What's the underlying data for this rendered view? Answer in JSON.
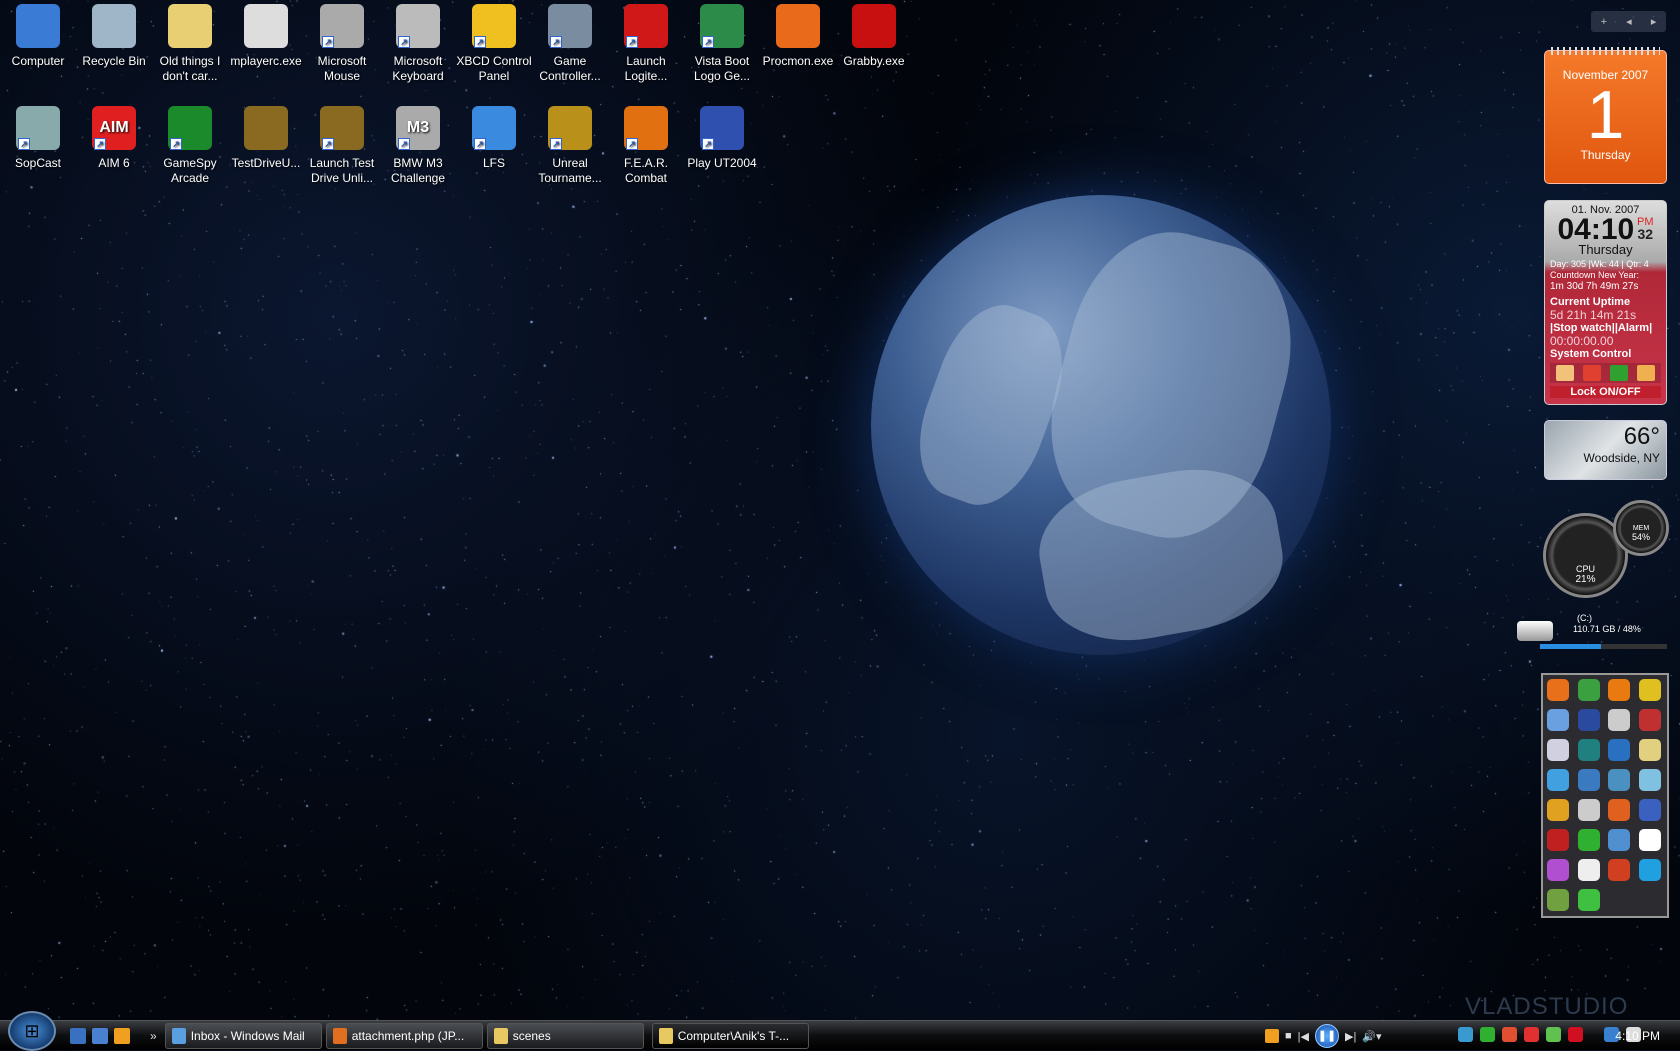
{
  "desktop": {
    "icons": [
      {
        "label": "Computer",
        "color": "#3a7bd5",
        "shortcut": false
      },
      {
        "label": "Recycle Bin",
        "color": "#9fb5c8",
        "shortcut": false
      },
      {
        "label": "Old things I don't car...",
        "color": "#e8cf74",
        "shortcut": false
      },
      {
        "label": "mplayerc.exe",
        "color": "#ddd",
        "shortcut": false
      },
      {
        "label": "Microsoft Mouse",
        "color": "#aaa",
        "shortcut": true
      },
      {
        "label": "Microsoft Keyboard",
        "color": "#bbb",
        "shortcut": true
      },
      {
        "label": "XBCD Control Panel",
        "color": "#f0c020",
        "shortcut": true
      },
      {
        "label": "Game Controller...",
        "color": "#7a8ca0",
        "shortcut": true
      },
      {
        "label": "Launch Logite...",
        "color": "#d01818",
        "shortcut": true
      },
      {
        "label": "Vista Boot Logo Ge...",
        "color": "#2d8b4a",
        "shortcut": true
      },
      {
        "label": "Procmon.exe",
        "color": "#e86a1a",
        "shortcut": false
      },
      {
        "label": "Grabby.exe",
        "color": "#c81010",
        "shortcut": false
      },
      {
        "label": "SopCast",
        "color": "#8aa",
        "shortcut": true
      },
      {
        "label": "AIM 6",
        "color": "#e02020",
        "shortcut": true,
        "glyph": "AIM"
      },
      {
        "label": "GameSpy Arcade",
        "color": "#1a8a2a",
        "shortcut": true
      },
      {
        "label": "TestDriveU...",
        "color": "#8a6a20",
        "shortcut": false
      },
      {
        "label": "Launch Test Drive Unli...",
        "color": "#8a6a20",
        "shortcut": true
      },
      {
        "label": "BMW M3 Challenge",
        "color": "#aaa",
        "shortcut": true,
        "glyph": "M3"
      },
      {
        "label": "LFS",
        "color": "#3a8ae0",
        "shortcut": true
      },
      {
        "label": "Unreal Tourname...",
        "color": "#b8901a",
        "shortcut": true
      },
      {
        "label": "F.E.A.R. Combat",
        "color": "#e07010",
        "shortcut": true
      },
      {
        "label": "Play UT2004",
        "color": "#3050b0",
        "shortcut": true
      }
    ]
  },
  "sidebar": {
    "controls": [
      "+",
      "◂",
      "▸"
    ]
  },
  "calendar": {
    "month": "November 2007",
    "day": "1",
    "weekday": "Thursday"
  },
  "clock": {
    "date": "01. Nov. 2007",
    "time": "04:10",
    "ampm": "PM",
    "seconds": "32",
    "weekday": "Thursday",
    "info": "Day: 305 |Wk: 44 | Qtr: 4",
    "countdown_label": "Countdown New Year:",
    "countdown": "1m  30d  7h  49m 27s",
    "uptime_label": "Current Uptime",
    "uptime": "5d 21h 14m 21s",
    "stopwatch_label": "|Stop watch||Alarm|",
    "stopwatch": "00:00:00.00",
    "system_label": "System Control",
    "lock": "Lock ON/OFF",
    "control_colors": [
      "#f3c27a",
      "#e04030",
      "#30a030",
      "#f0b050"
    ]
  },
  "weather": {
    "temp": "66°",
    "location": "Woodside, NY"
  },
  "meter": {
    "cpu_label": "CPU",
    "cpu": "21%",
    "mem_label": "MEM",
    "mem": "54%"
  },
  "drive": {
    "label": "(C:)",
    "info": "110.71 GB / 48%",
    "used_percent": 48
  },
  "launcher": {
    "colors": [
      "#e8701a",
      "#3aa040",
      "#e87a10",
      "#e0c020",
      "#6aa0e0",
      "#2a4aa0",
      "#ccc",
      "#c03030",
      "#d0d0e0",
      "#208080",
      "#2a70c0",
      "#e0d080",
      "#40a0e0",
      "#3a7ac0",
      "#4a90c0",
      "#80c0e0",
      "#e0a020",
      "#ccc",
      "#e06020",
      "#3a60c0",
      "#c02020",
      "#30b030",
      "#5090d0",
      "#fff",
      "#b050d0",
      "#eee",
      "#d04020",
      "#20a0e0",
      "#70a040",
      "#40c040"
    ]
  },
  "watermark": "VLADSTUDIO",
  "taskbar": {
    "start_glyph": "⊞",
    "quicklaunch_colors": [
      "#3a70c0",
      "#4a80d0",
      "#f0a020"
    ],
    "more": "»",
    "tasks": [
      {
        "label": "Inbox - Windows Mail",
        "color": "#5aa0e0",
        "active": false
      },
      {
        "label": "attachment.php (JP...",
        "color": "#e07020",
        "active": false
      },
      {
        "label": "scenes",
        "color": "#e8c860",
        "active": false
      },
      {
        "label": "Computer\\Anik's T-...",
        "color": "#e8c860",
        "active": true
      }
    ],
    "media": {
      "stop": "■",
      "prev": "|◀",
      "pause": "❚❚",
      "next": "▶|",
      "volume": "🔊▾"
    },
    "tray_colors": [
      "#3a9ad0",
      "#30b030",
      "#e05030",
      "#e03030",
      "#60c050",
      "#d01020",
      "#3a80d0",
      "#ddd"
    ],
    "time": "4:10 PM"
  }
}
